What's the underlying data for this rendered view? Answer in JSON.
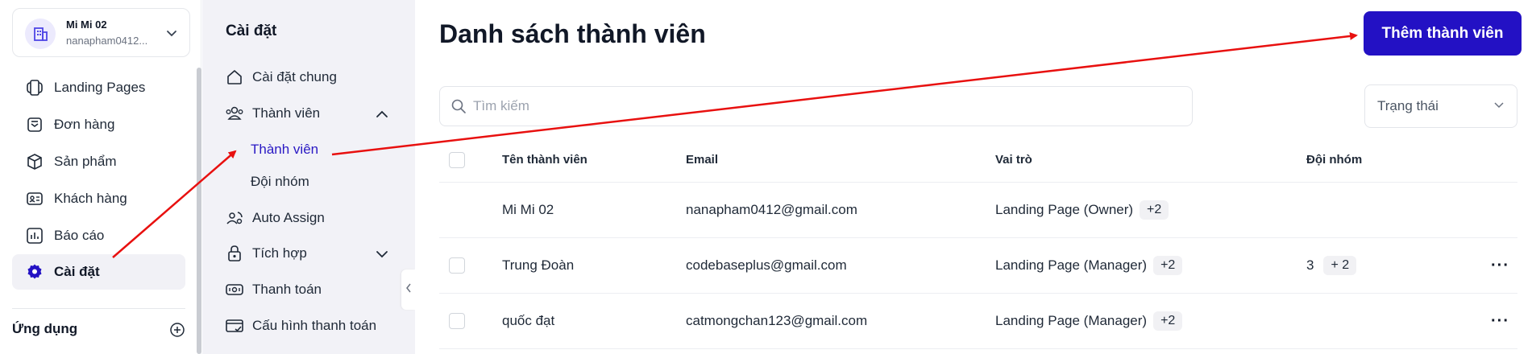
{
  "workspace": {
    "name": "Mi Mi 02",
    "email": "nanapham0412..."
  },
  "leftnav": {
    "items": [
      {
        "label": "Landing Pages",
        "icon": "landing-pages-icon"
      },
      {
        "label": "Đơn hàng",
        "icon": "orders-icon"
      },
      {
        "label": "Sản phẩm",
        "icon": "box-icon"
      },
      {
        "label": "Khách hàng",
        "icon": "contact-card-icon"
      },
      {
        "label": "Báo cáo",
        "icon": "bar-chart-icon"
      },
      {
        "label": "Cài đặt",
        "icon": "gear-icon",
        "active": true
      }
    ],
    "apps_label": "Ứng dụng"
  },
  "settings": {
    "title": "Cài đặt",
    "items": [
      {
        "label": "Cài đặt chung"
      },
      {
        "label": "Thành viên",
        "expanded": true
      },
      {
        "label": "Auto Assign"
      },
      {
        "label": "Tích hợp",
        "expanded": false
      },
      {
        "label": "Thanh toán"
      },
      {
        "label": "Cấu hình thanh toán"
      }
    ],
    "subitems": [
      {
        "label": "Thành viên",
        "active": true
      },
      {
        "label": "Đội nhóm"
      }
    ]
  },
  "main": {
    "title": "Danh sách thành viên",
    "add_button": "Thêm thành viên",
    "search_placeholder": "Tìm kiếm",
    "status_filter": "Trạng thái",
    "columns": {
      "name": "Tên thành viên",
      "email": "Email",
      "role": "Vai trò",
      "team": "Đội nhóm"
    },
    "rows": [
      {
        "name": "Mi Mi 02",
        "email": "nanapham0412@gmail.com",
        "role": "Landing Page (Owner)",
        "role_extra": "+2",
        "team_count": "",
        "team_extra": "",
        "checkbox": false,
        "more": false
      },
      {
        "name": "Trung Đoàn",
        "email": "codebaseplus@gmail.com",
        "role": "Landing Page (Manager)",
        "role_extra": "+2",
        "team_count": "3",
        "team_extra": "+ 2",
        "checkbox": true,
        "more": true
      },
      {
        "name": "quốc đạt",
        "email": "catmongchan123@gmail.com",
        "role": "Landing Page (Manager)",
        "role_extra": "+2",
        "team_count": "",
        "team_extra": "",
        "checkbox": true,
        "more": true
      }
    ],
    "more_glyph": "···"
  },
  "colors": {
    "accent": "#2311c4",
    "active_link": "#2a19c4",
    "annotation_arrow": "#e8100f",
    "settings_bg": "#f2f2f7"
  }
}
